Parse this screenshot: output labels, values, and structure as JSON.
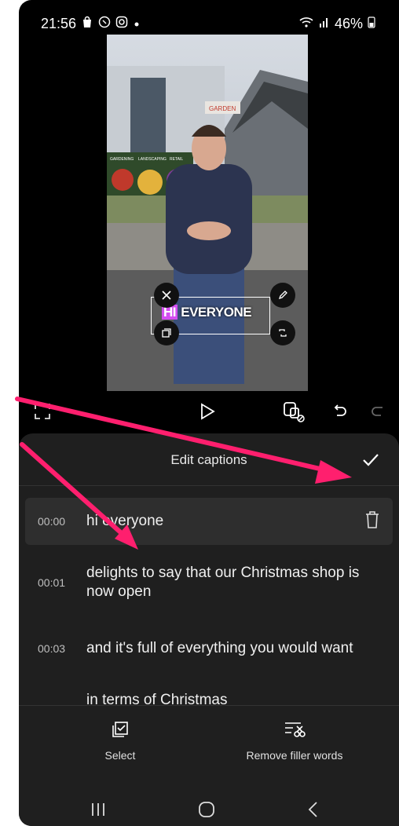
{
  "status": {
    "time": "21:56",
    "battery": "46%",
    "left_icons": [
      "bag-icon",
      "whatsapp-icon",
      "instagram-icon",
      "dot-icon"
    ],
    "right_icons": [
      "wifi-icon",
      "signal-icon",
      "battery-icon"
    ]
  },
  "video": {
    "sign_text": "GARDEN",
    "mural_labels": [
      "GARDENING",
      "LANDSCAPING",
      "RETAIL"
    ],
    "caption_highlight": "HI",
    "caption_rest": "EVERYONE"
  },
  "controls": {
    "icons": [
      "expand-icon",
      "play-icon",
      "caption-edit-icon",
      "undo-icon",
      "redo-icon"
    ]
  },
  "sheet": {
    "title": "Edit captions",
    "captions": [
      {
        "time": "00:00",
        "text": "hi everyone",
        "active": true
      },
      {
        "time": "00:01",
        "text": "delights to say that our Christmas shop is now open"
      },
      {
        "time": "00:03",
        "text": "and it's full of everything you would want"
      },
      {
        "time": "",
        "text": "in terms of Christmas"
      }
    ]
  },
  "bottom": {
    "select_label": "Select",
    "remove_label": "Remove filler words"
  },
  "nav": {
    "icons": [
      "recent-apps-icon",
      "home-icon",
      "back-icon"
    ]
  },
  "annotation_color": "#ff1f6e"
}
